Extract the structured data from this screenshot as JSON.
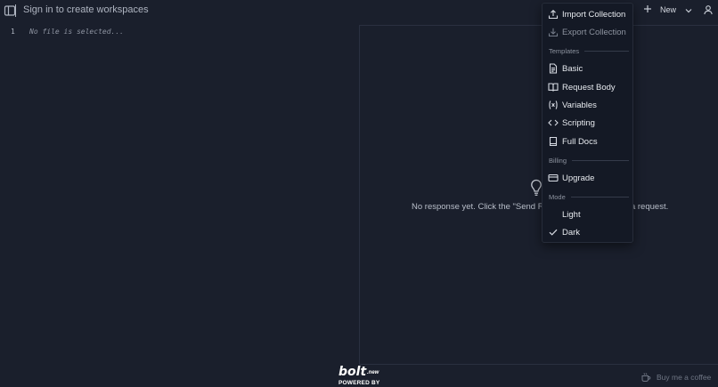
{
  "topbar": {
    "signin_label": "Sign in to create workspaces",
    "new_label": "New"
  },
  "editor": {
    "line_number": "1",
    "placeholder": "No file is selected..."
  },
  "response": {
    "empty_message": "No response yet. Click the \"Send Request\" button to send a request."
  },
  "menu": {
    "import_label": "Import Collection",
    "export_label": "Export Collection",
    "templates_heading": "Templates",
    "templates": [
      {
        "label": "Basic",
        "icon": "document-icon"
      },
      {
        "label": "Request Body",
        "icon": "book-icon"
      },
      {
        "label": "Variables",
        "icon": "variable-icon"
      },
      {
        "label": "Scripting",
        "icon": "code-icon"
      },
      {
        "label": "Full Docs",
        "icon": "docs-icon"
      }
    ],
    "billing_heading": "Billing",
    "upgrade_label": "Upgrade",
    "mode_heading": "Mode",
    "modes": [
      {
        "label": "Light",
        "selected": false
      },
      {
        "label": "Dark",
        "selected": true
      }
    ]
  },
  "footer": {
    "bolt_word": "bolt",
    "bolt_suffix": ".new",
    "powered_by": "POWERED BY",
    "coffee_label": "Buy me a coffee"
  },
  "colors": {
    "background": "#1a1f2c",
    "menu_background": "#141925",
    "text": "#d6dae2",
    "muted_text": "#8c929e"
  }
}
